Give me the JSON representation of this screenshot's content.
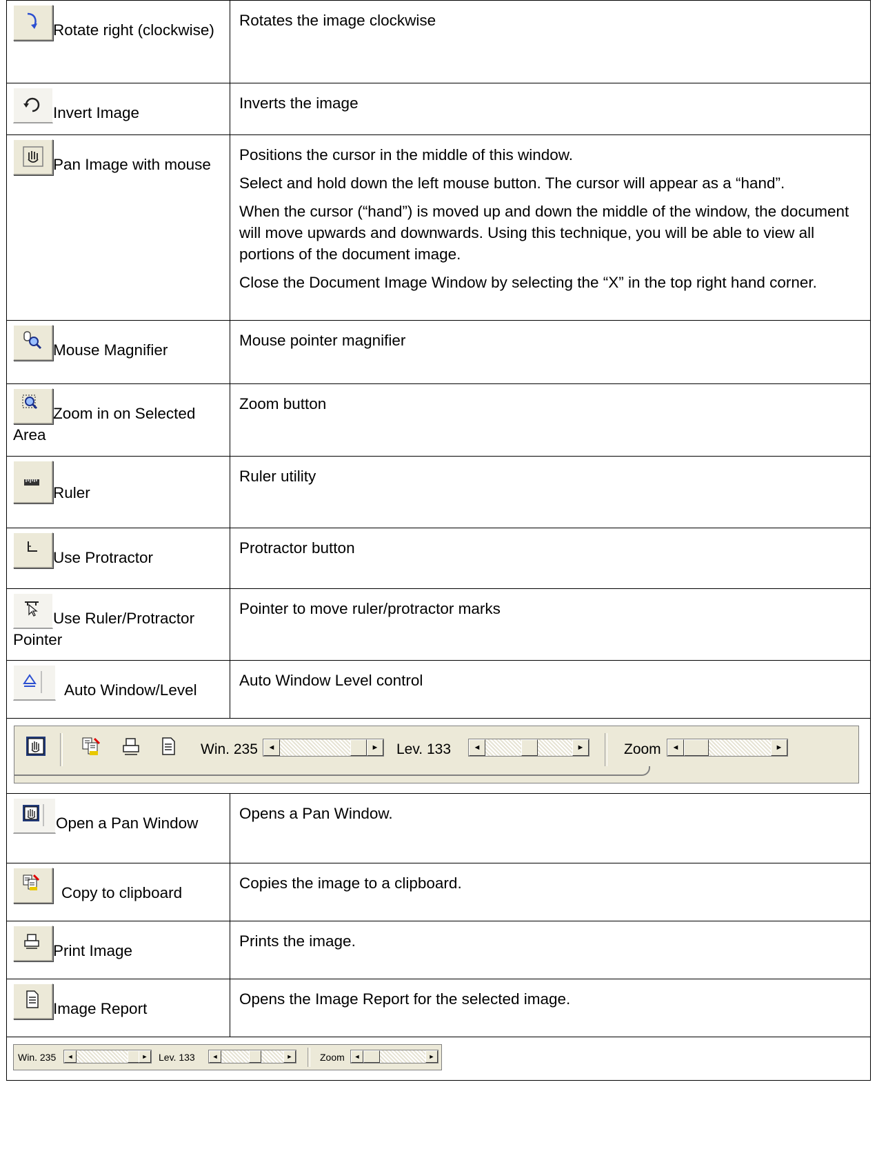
{
  "rows": [
    {
      "label": "Rotate right (clockwise)",
      "icon": "rotate-right-icon",
      "desc": [
        "Rotates the image clockwise"
      ]
    },
    {
      "label": "Invert Image",
      "icon": "invert-icon",
      "desc": [
        "Inverts the image"
      ]
    },
    {
      "label": "Pan Image with mouse",
      "icon": "pan-hand-icon",
      "desc": [
        "Positions the cursor in the middle of this window.",
        "Select and hold down the left mouse button. The cursor will appear as a “hand”.",
        "When the cursor (“hand”) is moved up and down the middle of the window, the document will move upwards and downwards. Using this technique, you will be able to view all portions of the document image.",
        "Close the Document Image Window by selecting the “X” in the top right hand corner."
      ]
    },
    {
      "label": "Mouse Magnifier",
      "icon": "mouse-magnifier-icon",
      "desc": [
        "Mouse pointer magnifier"
      ]
    },
    {
      "label": "Zoom in on Selected Area",
      "icon": "zoom-area-icon",
      "desc": [
        "Zoom button"
      ]
    },
    {
      "label": "Ruler",
      "icon": "ruler-icon",
      "desc": [
        "Ruler utility"
      ]
    },
    {
      "label": "Use Protractor",
      "icon": "protractor-icon",
      "desc": [
        "Protractor button"
      ]
    },
    {
      "label": "Use Ruler/Protractor Pointer",
      "icon": "ruler-pointer-icon",
      "desc": [
        "Pointer to move ruler/protractor marks"
      ]
    },
    {
      "label": "Auto Window/Level",
      "icon": "auto-window-level-icon",
      "desc": [
        "Auto Window Level control"
      ]
    },
    {
      "label": "Open a Pan Window",
      "icon": "pan-window-icon",
      "desc": [
        "Opens a Pan Window."
      ]
    },
    {
      "label": "Copy to clipboard",
      "icon": "copy-clipboard-icon",
      "desc": [
        "Copies the image to a clipboard."
      ]
    },
    {
      "label": "Print Image",
      "icon": "print-icon",
      "desc": [
        "Prints the image."
      ]
    },
    {
      "label": "Image Report",
      "icon": "image-report-icon",
      "desc": [
        "Opens the Image Report for the selected image."
      ]
    }
  ],
  "toolbar": {
    "win_label": "Win. 235",
    "lev_label": "Lev. 133",
    "zoom_label": "Zoom",
    "left_arrow": "◄",
    "right_arrow": "►"
  }
}
